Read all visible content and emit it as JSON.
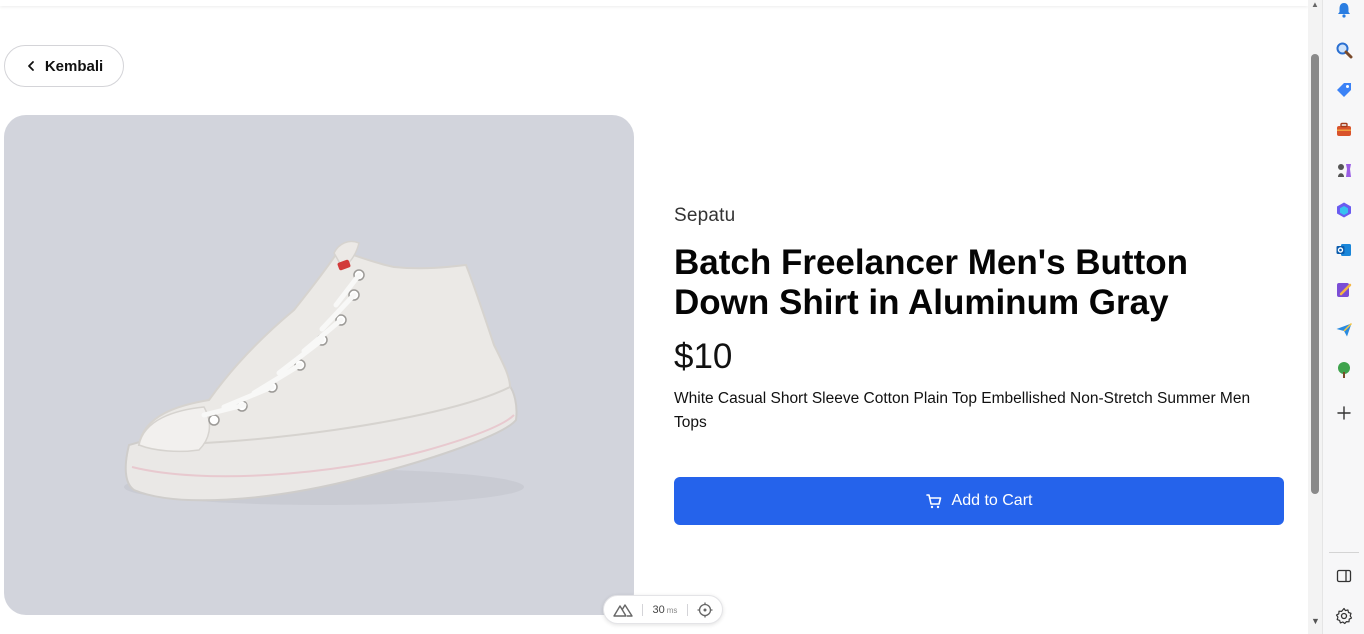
{
  "nav": {
    "back_label": "Kembali"
  },
  "product": {
    "category": "Sepatu",
    "title": "Batch Freelancer Men's Button Down Shirt in Aluminum Gray",
    "price": "$10",
    "description": "White Casual Short Sleeve Cotton Plain Top Embellished Non-Stretch Summer Men Tops",
    "add_to_cart_label": "Add to Cart",
    "image_background": "#d2d4dc"
  },
  "dev_toolbar": {
    "timing_value": "30",
    "timing_unit": "ms"
  },
  "colors": {
    "primary": "#2563eb",
    "text": "#0a0a0a"
  },
  "sidebar_icons": [
    "bell-icon",
    "search-icon",
    "tag-icon",
    "briefcase-icon",
    "chess-icon",
    "copilot-icon",
    "outlook-icon",
    "designer-icon",
    "send-icon",
    "tree-icon",
    "add-icon",
    "split-view-icon",
    "settings-icon"
  ]
}
